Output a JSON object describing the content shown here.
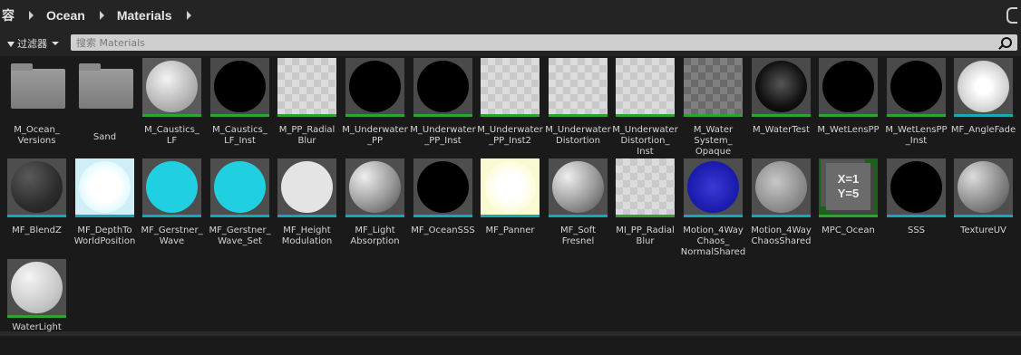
{
  "breadcrumb": {
    "items": [
      "容",
      "Ocean",
      "Materials"
    ]
  },
  "toolbar": {
    "filter_label": "过滤器",
    "search_placeholder": "搜索 Materials"
  },
  "assets": [
    {
      "label": "M_Ocean_\nVersions",
      "kind": "folder"
    },
    {
      "label": "Sand",
      "kind": "folder"
    },
    {
      "label": "M_Caustics_\nLF",
      "kind": "material",
      "bar": "green"
    },
    {
      "label": "M_Caustics_\nLF_Inst",
      "kind": "material",
      "bar": "green"
    },
    {
      "label": "M_PP_Radial\nBlur",
      "kind": "material",
      "bar": "green"
    },
    {
      "label": "M_Underwater\n_PP",
      "kind": "material",
      "bar": "green"
    },
    {
      "label": "M_Underwater\n_PP_Inst",
      "kind": "material",
      "bar": "green"
    },
    {
      "label": "M_Underwater\n_PP_Inst2",
      "kind": "material",
      "bar": "green"
    },
    {
      "label": "M_Underwater\nDistortion",
      "kind": "material",
      "bar": "green"
    },
    {
      "label": "M_Underwater\nDistortion_\nInst",
      "kind": "material",
      "bar": "green"
    },
    {
      "label": "M_Water\nSystem_\nOpaque",
      "kind": "material",
      "bar": "green"
    },
    {
      "label": "M_WaterTest",
      "kind": "material",
      "bar": "green"
    },
    {
      "label": "M_WetLensPP",
      "kind": "material",
      "bar": "green"
    },
    {
      "label": "M_WetLensPP\n_Inst",
      "kind": "material",
      "bar": "green"
    },
    {
      "label": "MF_AngleFade",
      "kind": "function",
      "bar": "teal"
    },
    {
      "label": "MF_BlendZ",
      "kind": "function",
      "bar": "teal"
    },
    {
      "label": "MF_DepthTo\nWorldPosition",
      "kind": "function",
      "bar": "teal"
    },
    {
      "label": "MF_Gerstner_\nWave",
      "kind": "function",
      "bar": "teal"
    },
    {
      "label": "MF_Gerstner_\nWave_Set",
      "kind": "function",
      "bar": "teal"
    },
    {
      "label": "MF_Height\nModulation",
      "kind": "function",
      "bar": "teal"
    },
    {
      "label": "MF_Light\nAbsorption",
      "kind": "function",
      "bar": "teal"
    },
    {
      "label": "MF_OceanSSS",
      "kind": "function",
      "bar": "teal"
    },
    {
      "label": "MF_Panner",
      "kind": "function",
      "bar": "teal"
    },
    {
      "label": "MF_Soft\nFresnel",
      "kind": "function",
      "bar": "teal"
    },
    {
      "label": "MI_PP_Radial\nBlur",
      "kind": "instance",
      "bar": "green"
    },
    {
      "label": "Motion_4Way\nChaos_\nNormalShared",
      "kind": "function",
      "bar": "teal"
    },
    {
      "label": "Motion_4Way\nChaosShared",
      "kind": "function",
      "bar": "teal"
    },
    {
      "label": "MPC_Ocean",
      "kind": "collection",
      "bar": "green",
      "icon_text": "X=1\nY=5"
    },
    {
      "label": "SSS",
      "kind": "function",
      "bar": "teal"
    },
    {
      "label": "TextureUV",
      "kind": "function",
      "bar": "teal"
    },
    {
      "label": "WaterLight",
      "kind": "function",
      "bar": "green"
    }
  ],
  "colors": {
    "green_bar": "#2fa32f",
    "teal_bar": "#17a8b4",
    "background": "#1a1a1a"
  }
}
